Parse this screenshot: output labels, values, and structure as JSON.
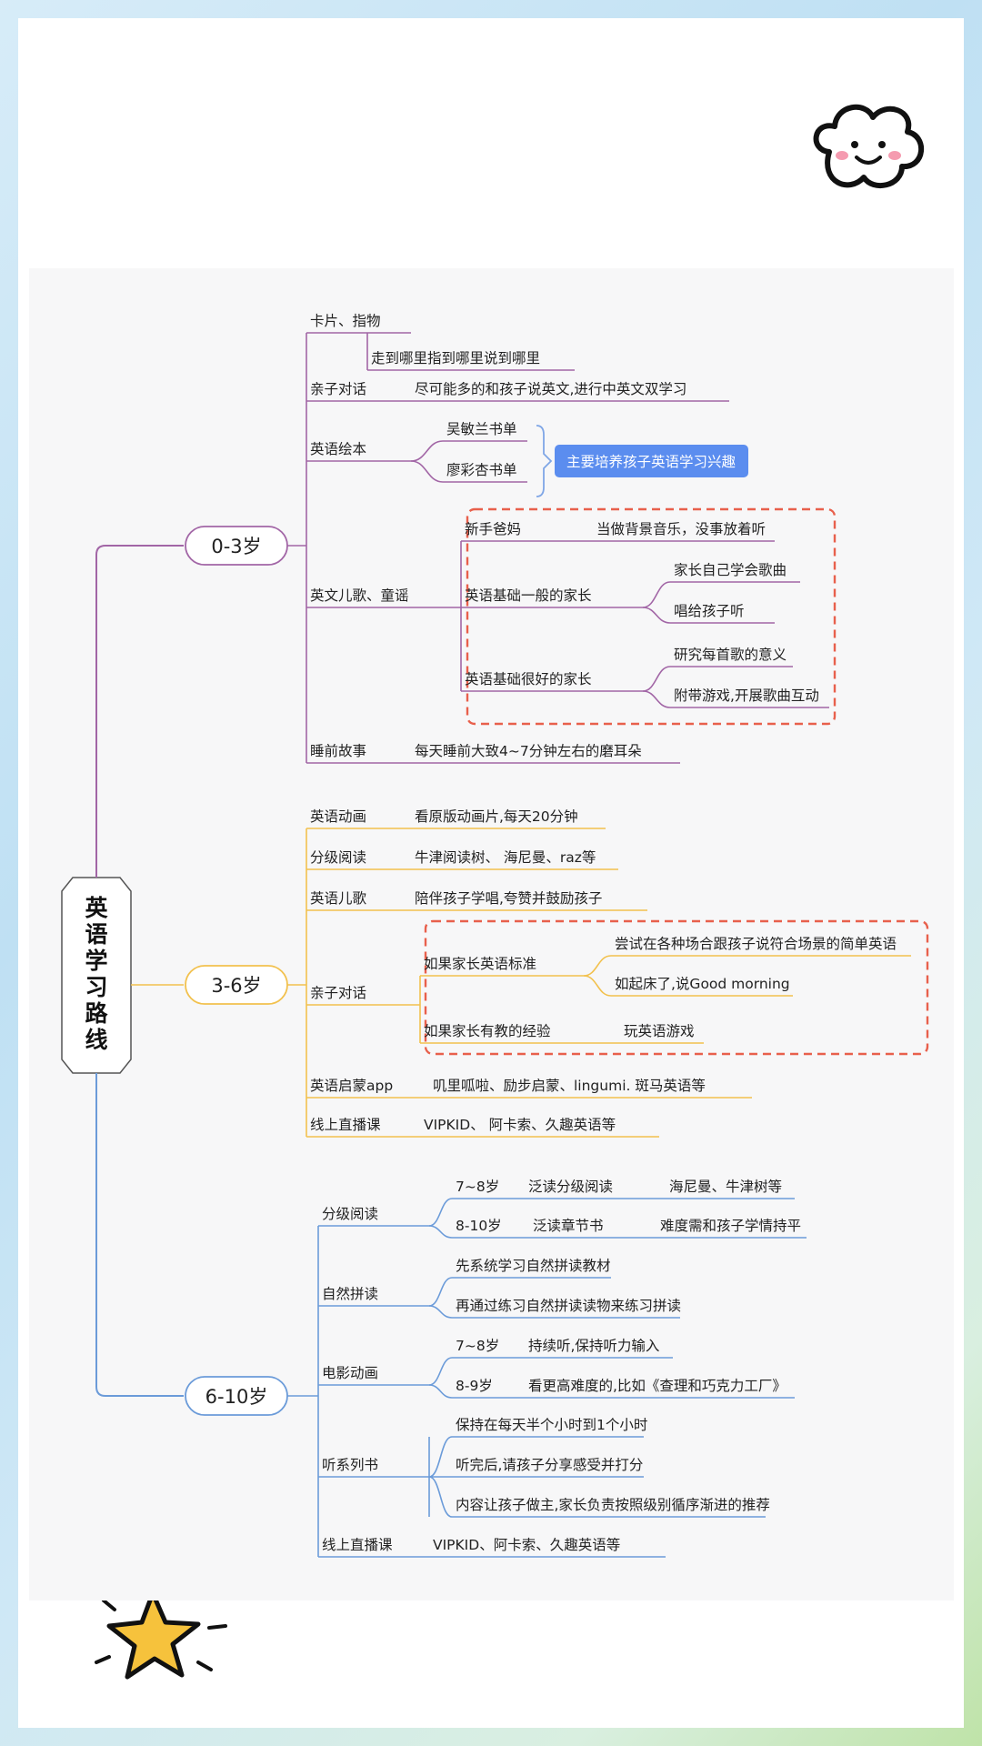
{
  "title": "英语学习路线",
  "colors": {
    "purple": "#a266a6",
    "yellow": "#f2c14e",
    "blue": "#6b9bd9",
    "dashed": "#e8604c",
    "note": "#5b8def"
  },
  "note": "主要培养孩子英语学习兴趣",
  "stages": [
    {
      "label": "0-3岁",
      "topics": [
        {
          "label": "卡片、指物",
          "children": [
            "走到哪里指到哪里说到哪里"
          ]
        },
        {
          "label": "亲子对话",
          "detail": "尽可能多的和孩子说英文,进行中英文双学习"
        },
        {
          "label": "英语绘本",
          "children": [
            "吴敏兰书单",
            "廖彩杏书单"
          ]
        },
        {
          "label": "英文儿歌、童谣",
          "groups": [
            {
              "label": "新手爸妈",
              "items": [
                "当做背景音乐，没事放着听"
              ]
            },
            {
              "label": "英语基础一般的家长",
              "items": [
                "家长自己学会歌曲",
                "唱给孩子听"
              ]
            },
            {
              "label": "英语基础很好的家长",
              "items": [
                "研究每首歌的意义",
                "附带游戏,开展歌曲互动"
              ]
            }
          ]
        },
        {
          "label": "睡前故事",
          "detail": "每天睡前大致4~7分钟左右的磨耳朵"
        }
      ]
    },
    {
      "label": "3-6岁",
      "topics": [
        {
          "label": "英语动画",
          "detail": "看原版动画片,每天20分钟"
        },
        {
          "label": "分级阅读",
          "detail": "牛津阅读树、 海尼曼、raz等"
        },
        {
          "label": "英语儿歌",
          "detail": "陪伴孩子学唱,夸赞并鼓励孩子"
        },
        {
          "label": "亲子对话",
          "groups": [
            {
              "label": "如果家长英语标准",
              "items": [
                "尝试在各种场合跟孩子说符合场景的简单英语",
                "如起床了,说Good morning"
              ]
            },
            {
              "label": "如果家长有教的经验",
              "items": [
                "玩英语游戏"
              ]
            }
          ]
        },
        {
          "label": "英语启蒙app",
          "detail": "叽里呱啦、励步启蒙、lingumi. 斑马英语等"
        },
        {
          "label": "线上直播课",
          "detail": "VIPKID、 阿卡索、久趣英语等"
        }
      ]
    },
    {
      "label": "6-10岁",
      "topics": [
        {
          "label": "分级阅读",
          "rows": [
            {
              "age": "7~8岁",
              "a": "泛读分级阅读",
              "b": "海尼曼、牛津树等"
            },
            {
              "age": "8-10岁",
              "a": "泛读章节书",
              "b": "难度需和孩子学情持平"
            }
          ]
        },
        {
          "label": "自然拼读",
          "children": [
            "先系统学习自然拼读教材",
            "再通过练习自然拼读读物来练习拼读"
          ]
        },
        {
          "label": "电影动画",
          "rows": [
            {
              "age": "7~8岁",
              "a": "持续听,保持听力输入"
            },
            {
              "age": "8-9岁",
              "a": "看更高难度的,比如《查理和巧克力工厂》"
            }
          ]
        },
        {
          "label": "听系列书",
          "children": [
            "保持在每天半个小时到1个小时",
            "听完后,请孩子分享感受并打分",
            "内容让孩子做主,家长负责按照级别循序渐进的推荐"
          ]
        },
        {
          "label": "线上直播课",
          "detail": "VIPKID、阿卡索、久趣英语等"
        }
      ]
    }
  ]
}
